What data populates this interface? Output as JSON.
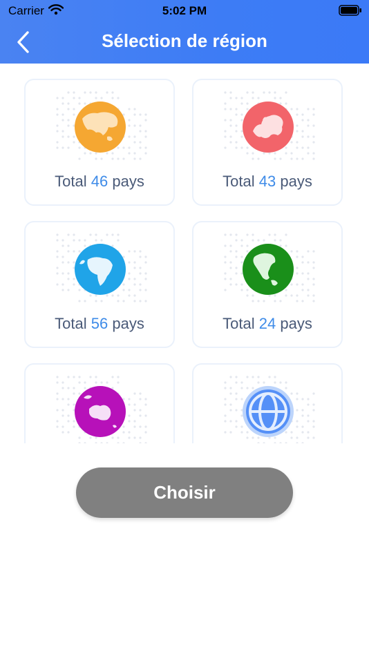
{
  "status_bar": {
    "carrier": "Carrier",
    "time": "5:02 PM"
  },
  "header": {
    "title": "Sélection de région"
  },
  "regions": [
    {
      "prefix": "Total",
      "count": "46",
      "suffix": "pays",
      "color": "#f5a732"
    },
    {
      "prefix": "Total",
      "count": "43",
      "suffix": "pays",
      "color": "#f2646a"
    },
    {
      "prefix": "Total",
      "count": "56",
      "suffix": "pays",
      "color": "#20a4e8"
    },
    {
      "prefix": "Total",
      "count": "24",
      "suffix": "pays",
      "color": "#1a8f1a"
    },
    {
      "prefix": "",
      "count": "",
      "suffix": "",
      "color": "#b711b9"
    },
    {
      "prefix": "",
      "count": "",
      "suffix": "",
      "color": "#5590f7"
    }
  ],
  "choose_button": {
    "label": "Choisir"
  },
  "colors": {
    "header": "#3d7cf5",
    "count_accent": "#3e8be8",
    "button": "#808080"
  }
}
